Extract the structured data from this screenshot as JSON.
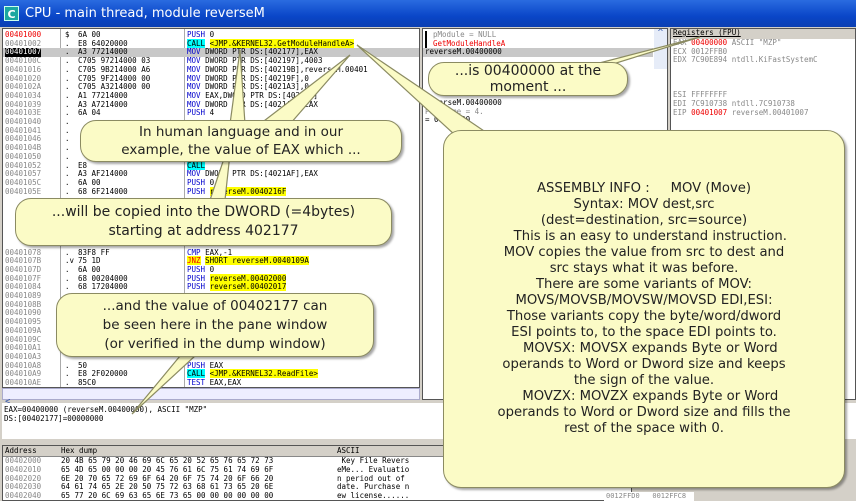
{
  "window": {
    "title": "CPU - main thread, module reverseM",
    "icon": "C"
  },
  "disasm": [
    [
      "00401000",
      "$",
      "6A 00",
      "PUSH",
      "0",
      "",
      ""
    ],
    [
      "00401002",
      ".",
      "E8 64020000",
      "CALL",
      "<JMP.&KERNEL32.GetModuleHandleA>",
      "call",
      "hl"
    ],
    [
      "00401007",
      ".",
      "A3 77214000",
      "MOV",
      "DWORD PTR DS:[402177],EAX",
      "",
      ""
    ],
    [
      "0040100C",
      ".",
      "C705 97214000 03",
      "MOV",
      "DWORD PTR DS:[402197],4003",
      "",
      ""
    ],
    [
      "00401016",
      ".",
      "C705 9B214000 A6",
      "MOV",
      "DWORD PTR DS:[40219B],reverseM.00401",
      "",
      ""
    ],
    [
      "00401020",
      ".",
      "C705 9F214000 00",
      "MOV",
      "DWORD PTR DS:[40219F],0",
      "",
      ""
    ],
    [
      "0040102A",
      ".",
      "C705 A3214000 00",
      "MOV",
      "DWORD PTR DS:[4021A3],0",
      "",
      ""
    ],
    [
      "00401034",
      ".",
      "A1 77214000",
      "MOV",
      "EAX,DWORD PTR DS:[402177]",
      "",
      ""
    ],
    [
      "00401039",
      ".",
      "A3 A7214000",
      "MOV",
      "DWORD PTR DS:[4021A7],EAX",
      "",
      ""
    ],
    [
      "0040103E",
      ".",
      "6A 04",
      "PUSH",
      "4",
      "",
      ""
    ],
    [
      "00401040",
      ".",
      "",
      "",
      "",
      "",
      ""
    ],
    [
      "00401041",
      ".",
      "",
      "",
      "",
      "",
      ""
    ],
    [
      "00401046",
      ".",
      "",
      "",
      "",
      "",
      ""
    ],
    [
      "0040104B",
      ".",
      "",
      "",
      "",
      "",
      ""
    ],
    [
      "00401050",
      ".",
      "",
      "",
      "",
      "",
      ""
    ],
    [
      "00401052",
      ".",
      "E8",
      "CALL",
      "",
      "call",
      ""
    ],
    [
      "00401057",
      ".",
      "A3 AF214000",
      "MOV",
      "DWORD PTR DS:[4021AF],EAX",
      "",
      ""
    ],
    [
      "0040105C",
      ".",
      "6A 00",
      "PUSH",
      "0",
      "",
      ""
    ],
    [
      "0040105E",
      ".",
      "68 6F214000",
      "PUSH",
      "reverseM.0040216F",
      "",
      "hl"
    ],
    [
      "",
      "",
      "",
      "",
      "",
      "",
      ""
    ],
    [
      "",
      "",
      "",
      "",
      "",
      "",
      ""
    ],
    [
      "",
      "",
      "",
      "",
      "",
      "",
      ""
    ],
    [
      "",
      "",
      "",
      "",
      "",
      "",
      ""
    ],
    [
      "",
      "",
      "",
      "",
      "",
      "",
      ""
    ],
    [
      "",
      "",
      "",
      "",
      "",
      "",
      ""
    ],
    [
      "00401078",
      ".",
      "83F8 FF",
      "CMP",
      "EAX,-1",
      "",
      ""
    ],
    [
      "0040107B",
      ".v",
      "75 1D",
      "JNZ",
      "SHORT reverseM.0040109A",
      "jmp",
      "hl"
    ],
    [
      "0040107D",
      ".",
      "6A 00",
      "PUSH",
      "0",
      "",
      ""
    ],
    [
      "0040107F",
      ".",
      "68 00204000",
      "PUSH",
      "reverseM.00402000",
      "",
      "hl"
    ],
    [
      "00401084",
      ".",
      "68 17204000",
      "PUSH",
      "reverseM.00402017",
      "",
      "hl"
    ],
    [
      "00401089",
      "",
      "",
      "",
      "",
      "",
      ""
    ],
    [
      "0040108B",
      "",
      "",
      "",
      "",
      "",
      ""
    ],
    [
      "00401090",
      "",
      "",
      "",
      "",
      "",
      ""
    ],
    [
      "00401095",
      "",
      "",
      "",
      "",
      "",
      ""
    ],
    [
      "0040109A",
      "",
      "",
      "",
      "",
      "",
      ""
    ],
    [
      "0040109C",
      "",
      "",
      "",
      "",
      "",
      ""
    ],
    [
      "004010A1",
      "",
      "",
      "",
      "",
      "",
      ""
    ],
    [
      "004010A3",
      "",
      "",
      "",
      "",
      "",
      ""
    ],
    [
      "004010A8",
      ".",
      "50",
      "PUSH",
      "EAX",
      "",
      ""
    ],
    [
      "004010A9",
      ".",
      "E8 2F020000",
      "CALL",
      "<JMP.&KERNEL32.ReadFile>",
      "call",
      "hl"
    ],
    [
      "004010AE",
      ".",
      "85C0",
      "TEST",
      "EAX,EAX",
      "",
      ""
    ]
  ],
  "comments": {
    "lines": [
      "pModule = NULL",
      "GetModuleHandleA",
      "reverseM.00400000"
    ],
    "lines2": [
      "reverseM.00400000",
      "ProcName = 4.",
      "= 00400000"
    ]
  },
  "registers": {
    "title": "Registers (FPU)",
    "rows": [
      {
        "name": "EAX",
        "value": "00400000",
        "comment": "ASCII \"MZP\"",
        "changed": true
      },
      {
        "name": "ECX",
        "value": "0012FFB0",
        "comment": "",
        "changed": false
      },
      {
        "name": "EDX",
        "value": "7C90E894",
        "comment": "ntdll.KiFastSystemC",
        "changed": false
      },
      {
        "name": "",
        "value": "",
        "comment": "",
        "changed": false
      },
      {
        "name": "",
        "value": "",
        "comment": "",
        "changed": false
      },
      {
        "name": "",
        "value": "",
        "comment": "",
        "changed": false
      },
      {
        "name": "ESI",
        "value": "FFFFFFFF",
        "comment": "",
        "changed": false
      },
      {
        "name": "EDI",
        "value": "7C910738",
        "comment": "ntdll.7C910738",
        "changed": false
      },
      {
        "name": "EIP",
        "value": "00401007",
        "comment": "reverseM.00401007",
        "changed": true
      }
    ]
  },
  "info": {
    "line1": "EAX=00400000 (reverseM.00400000), ASCII \"MZP\"",
    "line2": "DS:[00402177]=00000000"
  },
  "dump": {
    "headers": [
      "Address",
      "Hex dump",
      "ASCII"
    ],
    "rows": [
      [
        "00402000",
        "20 4B 65 79 20 46 69 6C 65 20 52 65 76 65 72 73",
        " Key File Revers"
      ],
      [
        "00402010",
        "65 4D 65 00 00 00 20 45 76 61 6C 75 61 74 69 6F",
        "eMe... Evaluatio"
      ],
      [
        "00402020",
        "6E 20 70 65 72 69 6F 64 20 6F 75 74 20 6F 66 20",
        "n period out of "
      ],
      [
        "00402030",
        "64 61 74 65 2E 20 50 75 72 63 68 61 73 65 20 6E",
        "date. Purchase n"
      ],
      [
        "00402040",
        "65 77 20 6C 69 63 65 6E 73 65 00 00 00 00 00 00",
        "ew license......"
      ]
    ]
  },
  "stack": [
    "0012FFD0",
    "0012FFC8"
  ],
  "balloons": {
    "eax_value": "...is 00400000 at the moment ...",
    "human": [
      "In human language and in our",
      "example, the value of EAX which ..."
    ],
    "copied": [
      "...will be copied into the DWORD (=4bytes)",
      "starting at address 402177"
    ],
    "pane": [
      "...and the value  of 00402177 can",
      "be seen here in the pane window",
      "(or verified in the dump window)"
    ],
    "info": [
      "ASSEMBLY INFO :     MOV (Move)",
      "Syntax: MOV dest,src",
      "(dest=destination, src=source)",
      "",
      "   This is an easy to understand instruction.",
      "MOV copies the value from src to dest and",
      "src stays what it was before.",
      "",
      "There are some variants of MOV:",
      "MOVS/MOVSB/MOVSW/MOVSD EDI,ESI:",
      "Those variants copy the byte/word/dword",
      "ESI points to, to the space EDI points to.",
      "   MOVSX: MOVSX expands Byte or Word",
      "operands to Word or Dword size and keeps",
      "the sign of the value.",
      "   MOVZX: MOVZX expands Byte or Word",
      "operands to Word or Dword size and fills the",
      "rest of the space with 0."
    ]
  },
  "colors": {
    "balloon": "#fbfbc6",
    "title_bar": "#0a46c8",
    "highlight": "#ffff00",
    "changed_register": "#e00000"
  }
}
